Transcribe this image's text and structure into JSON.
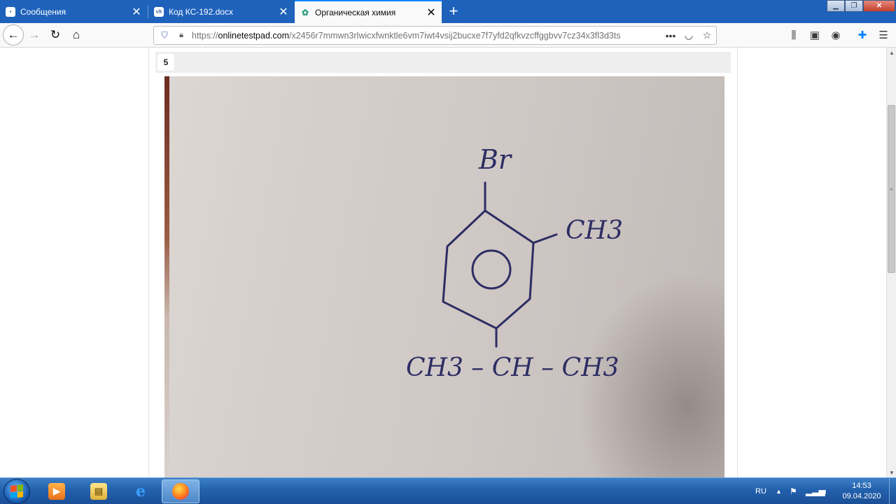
{
  "browser": {
    "tabs": [
      {
        "label": "Сообщения",
        "icon": "vk-messages-icon",
        "active": false
      },
      {
        "label": "Код КС-192.docx",
        "icon": "vk-icon",
        "active": false
      },
      {
        "label": "Органическая химия",
        "icon": "onlinetestpad-icon",
        "active": true
      }
    ],
    "new_tab_label": "+",
    "address": {
      "protocol": "https://",
      "host": "onlinetestpad.com",
      "path": "/x2456r7mmwn3rlwicxfwnktle6vm7iwt4vsij2bucxe7f7yfd2qfkvzcffggbvv7cz34x3fl3d3ts"
    },
    "accent_color": "#1e62bb"
  },
  "question": {
    "number": "5",
    "image_text": {
      "top": "Br",
      "right": "CH3",
      "bottom": "CH3 – CH – CH3"
    }
  },
  "taskbar": {
    "apps": [
      {
        "name": "media-player-icon"
      },
      {
        "name": "explorer-icon"
      },
      {
        "name": "internet-explorer-icon"
      },
      {
        "name": "firefox-icon",
        "active": true
      }
    ],
    "language": "RU",
    "time": "14:53",
    "date": "09.04.2020"
  }
}
